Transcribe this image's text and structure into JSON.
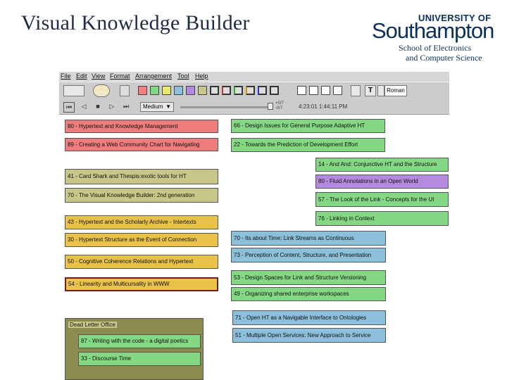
{
  "slide": {
    "title": "Visual Knowledge Builder"
  },
  "logo": {
    "line1": "UNIVERSITY OF",
    "line2": "Southampton",
    "line3": "School of Electronics",
    "line4": "and Computer Science"
  },
  "menu": [
    "File",
    "Edit",
    "View",
    "Format",
    "Arrangement",
    "Tool",
    "Help"
  ],
  "toolbar": {
    "font_label": "Roman",
    "zoom_value": "Medium",
    "time_display": "4:23:01 1:44:11 PM",
    "scale_top": "+0/7",
    "scale_bottom": "-0/7"
  },
  "colors": {
    "red": "#ef7d7d",
    "green": "#84d884",
    "tan": "#c8c689",
    "orange": "#e8c249",
    "blue": "#8cc0da",
    "purple": "#b48ae0"
  },
  "nodes": {
    "n1": "80 - Hypertext and Knowledge Management",
    "n2": "89 - Creating a Web Community Chart for Navigating",
    "n3": "66 - Design Issues for General Purpose Adaptive HT",
    "n4": "22 - Towards the Prediction of Development Effort",
    "n5": "14 - And And: Conjunctive HT and the Structure",
    "n6": "41 - Card Shark and Thespis:exotic tools for HT",
    "n7": "80 - Fluid Annotations in an Open World",
    "n8": "70 - The Visual Knowledge Builder: 2nd generation",
    "n9": "57 - The Look of the Link - Concepts for the UI",
    "n10": "76 - Linking in Context",
    "n11": "43 - Hypertext and the Scholarly Archive - Intertexts",
    "n12": "70 - Its about Time: Link Streams as Continuous",
    "n13": "30 - Hypertext Structure as the Event of Connection",
    "n14": "73 - Perception of Content, Structure, and Presentation",
    "n15": "50 - Cognitive Coherence Relations and Hypertext",
    "n16": "53 - Design Spaces for Link and Structure Versioning",
    "n17": "54 - Linearity and Multicursality in WWW",
    "n18": "49 - Organizing shared enterprise workspaces",
    "n19": "71 - Open HT as a Navigable Interface to Ontologies",
    "n20": "51 - Multiple Open Services: New Approach to Service",
    "dock_label": "Dead Letter Office",
    "d1": "87 - Writing with the code - a digital poetics",
    "d2": "33 - Discourse Time"
  }
}
